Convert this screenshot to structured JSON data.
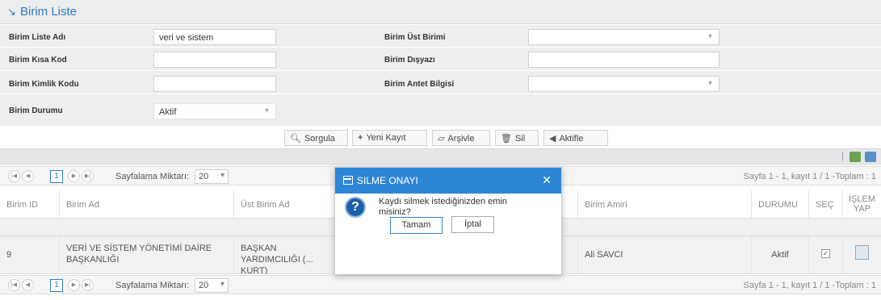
{
  "panel": {
    "title": "Birim Liste"
  },
  "form": {
    "liste_adi": {
      "label": "Birim Liste Adı",
      "value": "veri ve sistem"
    },
    "ust_birimi": {
      "label": "Birim Üst Birimi",
      "value": ""
    },
    "kisa_kod": {
      "label": "Birim Kısa Kod",
      "value": ""
    },
    "disyazi": {
      "label": "Birim Dışyazı",
      "value": ""
    },
    "kimlik_kodu": {
      "label": "Birim Kimlik Kodu",
      "value": ""
    },
    "antet": {
      "label": "Birim Antet Bilgisi",
      "value": ""
    },
    "durumu": {
      "label": "Birim Durumu",
      "value": "Aktif"
    }
  },
  "toolbar": {
    "sorgula": "Sorgula",
    "yeni_kayit": "Yeni Kayıt",
    "arsivle": "Arşivle",
    "sil": "Sil",
    "aktifle": "Aktifle"
  },
  "pager": {
    "page": "1",
    "size_label": "Sayfalama Miktarı:",
    "size": "20",
    "info": "Sayfa 1 - 1, kayıt 1 / 1 -Toplam : 1"
  },
  "table": {
    "columns": [
      "Birim ID",
      "Birim Ad",
      "Üst Birim Ad",
      "Birim Amiri",
      "DURUMU",
      "SEÇ",
      "İŞLEM YAP"
    ],
    "row": {
      "id": "9",
      "ad": "VERİ VE SİSTEM YÖNETİMİ DAİRE BAŞKANLIĞI",
      "ust": "BAŞKAN YARDIMCILIĞI (... KURT)",
      "amir": "Ali SAVCI",
      "durum": "Aktif"
    }
  },
  "dialog": {
    "title": "SILME ONAYI",
    "message": "Kaydı silmek istediğinizden emin misiniz?",
    "ok": "Tamam",
    "cancel": "İptal"
  },
  "colors": {
    "accent": "#2e86d6",
    "title_blue": "#2e7dc4"
  }
}
